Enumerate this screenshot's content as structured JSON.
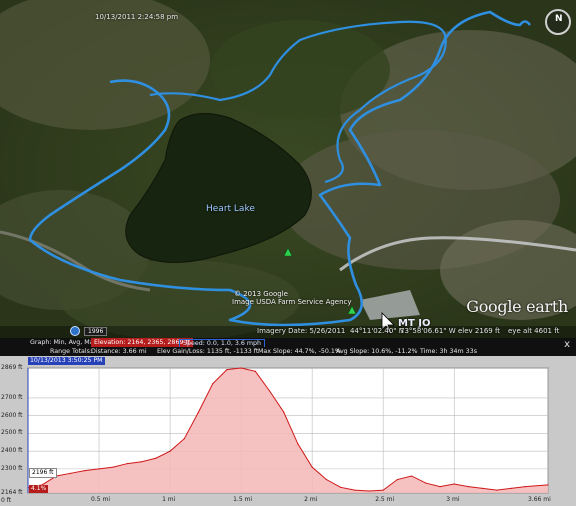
{
  "map": {
    "timestamp": "10/13/2011  2:24:58 pm",
    "lake_label": "Heart Lake",
    "copyright_line1": "© 2013 Google",
    "copyright_line2": "Image USDA Farm Service Agency",
    "brand": "Google earth",
    "year_badge": "1996",
    "status": {
      "imagery_date": "Imagery Date: 5/26/2011",
      "lat": "44°11'02.40\" N",
      "lon": "73°58'06.61\" W",
      "elev": "elev  2169 ft",
      "eye_alt": "eye alt   4601 ft"
    },
    "compass_label": "N",
    "map_text": "MT JO"
  },
  "profile": {
    "row1": {
      "graph_label": "Graph: Min, Avg, Max",
      "elevation": "Elevation: 2164, 2365, 2869 ft",
      "speed": "Speed: 0.0, 1.0, 3.6 mph"
    },
    "row2": {
      "range_totals": "Range Totals:",
      "distance": "Distance: 3.66 mi",
      "elev_gain": "Elev Gain/Loss: 1135 ft, -1133 ft",
      "max_slope": "Max Slope: 44.7%, -50.1%",
      "avg_slope": "Avg Slope: 10.6%, -11.2%",
      "time": "Time: 3h 34m 33s"
    },
    "close_label": "x",
    "cursor_time": "10/13/2013 3:50:25 PM",
    "cursor_elev": "2196 ft",
    "cursor_slope": "4.1%",
    "cursor_zero": "0 ft"
  },
  "chart_data": {
    "type": "area",
    "title": "",
    "xlabel": "",
    "ylabel": "",
    "y_ticks": [
      "2869 ft",
      "2700 ft",
      "2600 ft",
      "2500 ft",
      "2400 ft",
      "2300 ft",
      "2164 ft"
    ],
    "x_ticks": [
      "0.5 mi",
      "1 mi",
      "1.5 mi",
      "2 mi",
      "2.5 mi",
      "3 mi",
      "3.66 mi"
    ],
    "ylim": [
      2164,
      2869
    ],
    "xlim": [
      0,
      3.66
    ],
    "grid": true,
    "fill_color": "#f3b6b6",
    "line_color": "#d01818",
    "x": [
      0,
      0.1,
      0.2,
      0.3,
      0.4,
      0.5,
      0.6,
      0.7,
      0.8,
      0.9,
      1.0,
      1.1,
      1.2,
      1.3,
      1.4,
      1.5,
      1.6,
      1.7,
      1.8,
      1.9,
      2.0,
      2.1,
      2.2,
      2.3,
      2.4,
      2.5,
      2.6,
      2.7,
      2.8,
      2.9,
      3.0,
      3.1,
      3.2,
      3.3,
      3.4,
      3.5,
      3.66
    ],
    "y": [
      2196,
      2210,
      2260,
      2275,
      2290,
      2300,
      2310,
      2330,
      2340,
      2360,
      2400,
      2470,
      2620,
      2780,
      2860,
      2869,
      2850,
      2740,
      2620,
      2440,
      2310,
      2240,
      2196,
      2180,
      2175,
      2180,
      2240,
      2260,
      2220,
      2200,
      2215,
      2200,
      2190,
      2180,
      2190,
      2200,
      2210
    ]
  },
  "colors": {
    "trail": "#2f8fe0",
    "lake": "#1a2a16",
    "elev_highlight": "#b51c1c",
    "speed_highlight": "#2b62d8"
  }
}
